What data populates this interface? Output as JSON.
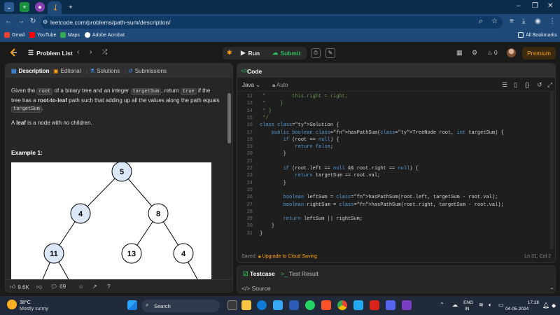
{
  "browser": {
    "url": "leetcode.com/problems/path-sum/description/",
    "bookmarks": [
      "Gmail",
      "YouTube",
      "Maps",
      "Adobe Acrobat"
    ],
    "all_bookmarks": "All Bookmarks"
  },
  "nav": {
    "problem_list": "Problem List",
    "run": "Run",
    "submit": "Submit",
    "streak": "0",
    "premium": "Premium"
  },
  "left": {
    "tabs": [
      "Description",
      "Editorial",
      "Solutions",
      "Submissions"
    ],
    "desc": {
      "p1": "Given the",
      "root": "root",
      "p2": "of a binary tree and an integer",
      "targetSum": "targetSum",
      "p3": ", return",
      "true": "true",
      "p4": "if the tree has a",
      "bold": "root-to-leaf",
      "p5": "path such that adding up all the values along the path equals",
      "p6": "."
    },
    "leaf_pre": "A",
    "leaf_bold": "leaf",
    "leaf_post": "is a node with no children.",
    "example_title": "Example 1:",
    "tree_nodes": [
      "5",
      "4",
      "8",
      "11",
      "13",
      "4"
    ],
    "footer": {
      "likes": "9.6K",
      "comments": "69"
    }
  },
  "code": {
    "title": "Code",
    "language": "Java",
    "auto": "Auto",
    "lines": [
      {
        "n": "12",
        "t": " *         this.right = right;",
        "k": "cm"
      },
      {
        "n": "13",
        "t": " *     }",
        "k": "cm"
      },
      {
        "n": "14",
        "t": " * }",
        "k": "cm"
      },
      {
        "n": "15",
        "t": " */",
        "k": "cm"
      },
      {
        "n": "16",
        "t": "class Solution {",
        "k": "cls"
      },
      {
        "n": "17",
        "t": "    public boolean hasPathSum(TreeNode root, int targetSum) {",
        "k": "sig"
      },
      {
        "n": "18",
        "t": "        if (root == null) {",
        "k": "if"
      },
      {
        "n": "19",
        "t": "            return false;",
        "k": "ret"
      },
      {
        "n": "20",
        "t": "        }",
        "k": "pu"
      },
      {
        "n": "21",
        "t": "",
        "k": "pu"
      },
      {
        "n": "22",
        "t": "        if (root.left == null && root.right == null) {",
        "k": "if"
      },
      {
        "n": "23",
        "t": "            return targetSum == root.val;",
        "k": "ret"
      },
      {
        "n": "24",
        "t": "        }",
        "k": "pu"
      },
      {
        "n": "25",
        "t": "",
        "k": "pu"
      },
      {
        "n": "26",
        "t": "        boolean leftSum = hasPathSum(root.left, targetSum - root.val);",
        "k": "decl"
      },
      {
        "n": "27",
        "t": "        boolean rightSum = hasPathSum(root.right, targetSum - root.val);",
        "k": "decl"
      },
      {
        "n": "28",
        "t": "",
        "k": "pu"
      },
      {
        "n": "29",
        "t": "        return leftSum || rightSum;",
        "k": "ret"
      },
      {
        "n": "30",
        "t": "    }",
        "k": "pu"
      },
      {
        "n": "31",
        "t": "}",
        "k": "pu"
      }
    ],
    "saved": "Saved",
    "upgrade": "Upgrade to Cloud Saving",
    "cursor": "Ln 31, Col 2"
  },
  "test": {
    "testcase": "Testcase",
    "result": "Test Result",
    "source": "Source"
  },
  "taskbar": {
    "temp": "38°C",
    "weather": "Mostly sunny",
    "search": "Search",
    "lang1": "ENG",
    "lang2": "IN",
    "time": "17:18",
    "date": "04-05-2024"
  }
}
